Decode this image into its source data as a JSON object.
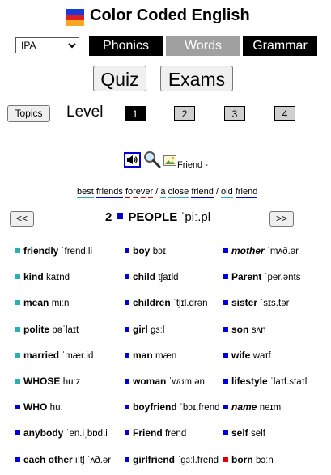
{
  "header": {
    "title": "Color Coded English",
    "logo_colors": [
      "#1a3bd6",
      "#e02020",
      "#f5a623"
    ]
  },
  "language_select": {
    "value": "IPA",
    "options": [
      "IPA"
    ]
  },
  "tabs": [
    {
      "label": "Phonics",
      "bg": "#000000"
    },
    {
      "label": "Words",
      "bg": "#a0a0a0"
    },
    {
      "label": "Grammar",
      "bg": "#000000"
    }
  ],
  "buttons": {
    "quiz": "Quiz",
    "exams": "Exams",
    "topics": "Topics",
    "prev": "<<",
    "next": ">>"
  },
  "level": {
    "label": "Level",
    "items": [
      "1",
      "2",
      "3",
      "4"
    ],
    "active": "1"
  },
  "word_tools": {
    "word": "Friend -"
  },
  "phrase": {
    "best": "best",
    "friends": "friends",
    "forever": "forever",
    "sep1": "/",
    "a": "a",
    "close": "close",
    "friend": "friend",
    "sep2": "/",
    "old": "old",
    "friend2": "friend"
  },
  "topic": {
    "number": "2",
    "name": "PEOPLE",
    "ipa": "ˈpiː.pl"
  },
  "colors": {
    "teal": "#2ab0b0",
    "blue": "#0000dd",
    "red": "#dd0000"
  },
  "word_columns": [
    [
      {
        "word": "friendly",
        "ipa": "ˈfrend.li",
        "color": "teal",
        "italic": false
      },
      {
        "word": "kind",
        "ipa": "kaɪnd",
        "color": "teal",
        "italic": false
      },
      {
        "word": "mean",
        "ipa": "miːn",
        "color": "teal",
        "italic": false
      },
      {
        "word": "polite",
        "ipa": "pəˈlaɪt",
        "color": "teal",
        "italic": false
      },
      {
        "word": "married",
        "ipa": "ˈmær.id",
        "color": "teal",
        "italic": false
      },
      {
        "word": "WHOSE",
        "ipa": "huːz",
        "color": "teal",
        "italic": false
      },
      {
        "word": "WHO",
        "ipa": "huː",
        "color": "blue",
        "italic": false
      },
      {
        "word": "anybody",
        "ipa": "ˈen.iˌbɒd.i",
        "color": "blue",
        "italic": false
      },
      {
        "word": "each other",
        "ipa": "iːtʃ ˈʌð.ər",
        "color": "blue",
        "italic": false
      }
    ],
    [
      {
        "word": "boy",
        "ipa": "bɔɪ",
        "color": "blue",
        "italic": false
      },
      {
        "word": "child",
        "ipa": "tʃaɪld",
        "color": "blue",
        "italic": false
      },
      {
        "word": "children",
        "ipa": "ˈtʃɪl.drən",
        "color": "blue",
        "italic": false
      },
      {
        "word": "girl",
        "ipa": "ɡɜːl",
        "color": "blue",
        "italic": false
      },
      {
        "word": "man",
        "ipa": "mæn",
        "color": "blue",
        "italic": false
      },
      {
        "word": "woman",
        "ipa": "ˈwʊm.ən",
        "color": "blue",
        "italic": false
      },
      {
        "word": "boyfriend",
        "ipa": "ˈbɔɪ.frend",
        "color": "blue",
        "italic": false
      },
      {
        "word": "Friend",
        "ipa": "frend",
        "color": "blue",
        "italic": false
      },
      {
        "word": "girlfriend",
        "ipa": "ˈɡɜːl.frend",
        "color": "blue",
        "italic": false
      }
    ],
    [
      {
        "word": "mother",
        "ipa": "ˈmʌð.ər",
        "color": "blue",
        "italic": true
      },
      {
        "word": "Parent",
        "ipa": "ˈper.ənts",
        "color": "blue",
        "italic": false
      },
      {
        "word": "sister",
        "ipa": "ˈsɪs.tər",
        "color": "blue",
        "italic": false
      },
      {
        "word": "son",
        "ipa": "sʌn",
        "color": "blue",
        "italic": false
      },
      {
        "word": "wife",
        "ipa": "waɪf",
        "color": "blue",
        "italic": false
      },
      {
        "word": "lifestyle",
        "ipa": "ˈlaɪf.staɪl",
        "color": "blue",
        "italic": false
      },
      {
        "word": "name",
        "ipa": "neɪm",
        "color": "blue",
        "italic": true
      },
      {
        "word": "self",
        "ipa": "self",
        "color": "blue",
        "italic": false
      },
      {
        "word": "born",
        "ipa": "bɔːn",
        "color": "red",
        "italic": false
      }
    ]
  ]
}
